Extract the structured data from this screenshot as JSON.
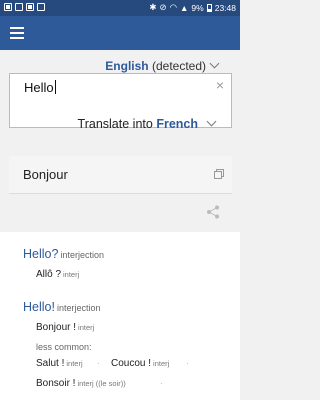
{
  "status": {
    "time": "23:48",
    "battery": "9%"
  },
  "source": {
    "language": "English",
    "detected": "(detected)",
    "text": "Hello"
  },
  "target": {
    "prefix": "Translate into",
    "language": "French",
    "result": "Bonjour"
  },
  "dictionary": {
    "entries": [
      {
        "headword": "Hello?",
        "pos": "interjection",
        "translations": [
          {
            "word": "Allô ?",
            "pos": "interj"
          }
        ]
      },
      {
        "headword": "Hello!",
        "pos": "interjection",
        "translations": [
          {
            "word": "Bonjour !",
            "pos": "interj"
          }
        ],
        "less_common_label": "less common:",
        "less_common": [
          {
            "word": "Salut !",
            "pos": "interj"
          },
          {
            "word": "Coucou !",
            "pos": "interj"
          },
          {
            "word": "Bonsoir !",
            "pos": "interj",
            "note": "((le soir))"
          }
        ]
      }
    ]
  }
}
